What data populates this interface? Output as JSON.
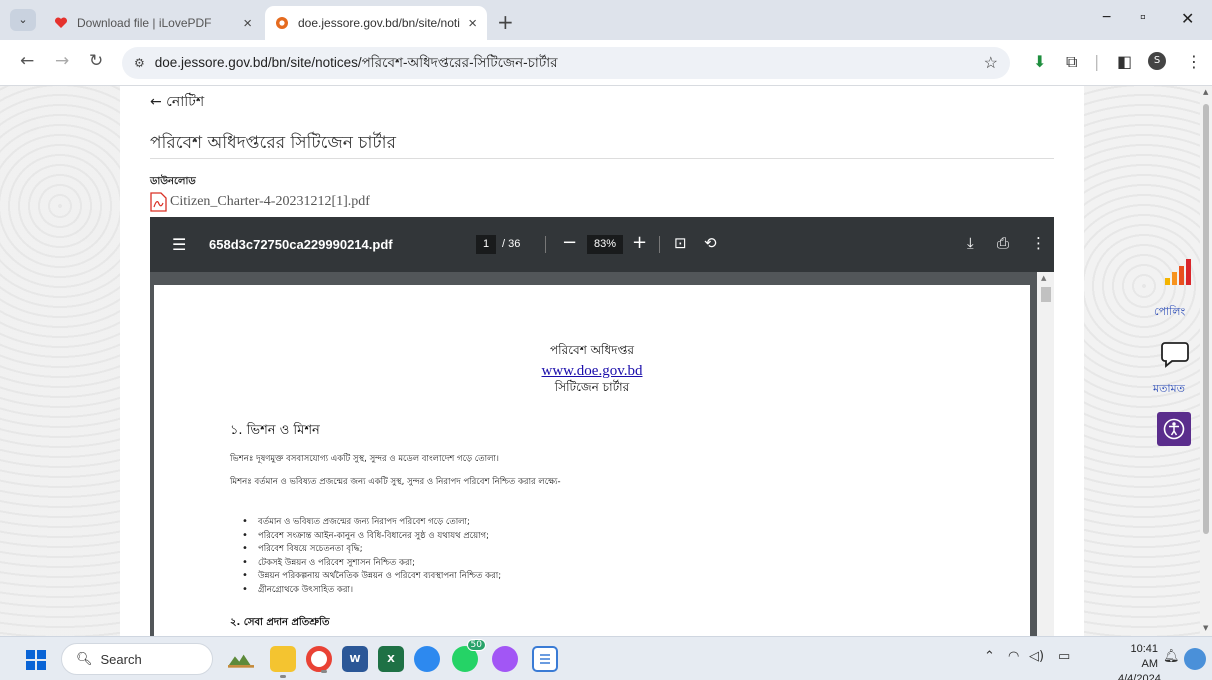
{
  "browser": {
    "tabs": [
      {
        "title": "Download file | iLovePDF",
        "active": false
      },
      {
        "title": "doe.jessore.gov.bd/bn/site/noti",
        "active": true
      }
    ],
    "url": "doe.jessore.gov.bd/bn/site/notices/পরিবেশ-অধিদপ্তরের-সিটিজেন-চার্টার",
    "profile_initial": "S"
  },
  "page": {
    "back_link": "← নোটিশ",
    "title": "পরিবেশ অধিদপ্তরের সিটিজেন চার্টার",
    "download_label": "ডাউনলোড",
    "pdf_filename": "Citizen_Charter-4-20231212[1].pdf"
  },
  "viewer": {
    "filename": "658d3c72750ca229990214.pdf",
    "page": "1",
    "total": "/ 36",
    "zoom": "83%"
  },
  "document": {
    "org": "পরিবেশ অধিদপ্তর",
    "website": "www.doe.gov.bd",
    "doc_title": "সিটিজেন চার্টার",
    "section1": "১. ভিশন ও মিশন",
    "vision": "ভিশনঃ দূষণমুক্ত বসবাসযোগ্য একটি সুস্থ, সুন্দর ও মডেল বাংলাদেশ গড়ে তোলা।",
    "mission": "মিশনঃ বর্তমান ও ভবিষ্যত প্রজন্মের জন্য একটি সুস্থ, সুন্দর ও নিরাপদ পরিবেশ নিশ্চিত করার লক্ষ্যে-",
    "bullets": [
      "বর্তমান ও ভবিষ্যত প্রজন্মের জন্য নিরাপদ পরিবেশ গড়ে তোলা;",
      "পরিবেশ সংক্রান্ত আইন-কানুন ও বিধি-বিধানের সুষ্ঠ ও যথাযথ প্রয়োগ;",
      "পরিবেশ বিষয়ে সচেতনতা বৃদ্ধি;",
      "টেকসই উন্নয়ন ও পরিবেশ সুশাসন নিশ্চিত করা;",
      "উন্নয়ন পরিকল্পনায় অর্থনৈতিক উন্নয়ন ও পরিবেশ ব্যবস্থাপনা নিশ্চিত করা;",
      "গ্রীনগ্রোথকে উৎসাহিত করা।"
    ],
    "section2": "২. সেবা প্রদান প্রতিশ্রুতি"
  },
  "side": {
    "poll_label": "পোলিং",
    "feedback_label": "মতামত"
  },
  "taskbar": {
    "search": "Search",
    "badge": "50",
    "time": "10:41 AM",
    "date": "4/4/2024"
  },
  "colors": {
    "link": "#1a0dab",
    "viewer_bar": "#323639",
    "accessibility": "#5a2d8c",
    "side_label": "#2a4bb8"
  }
}
